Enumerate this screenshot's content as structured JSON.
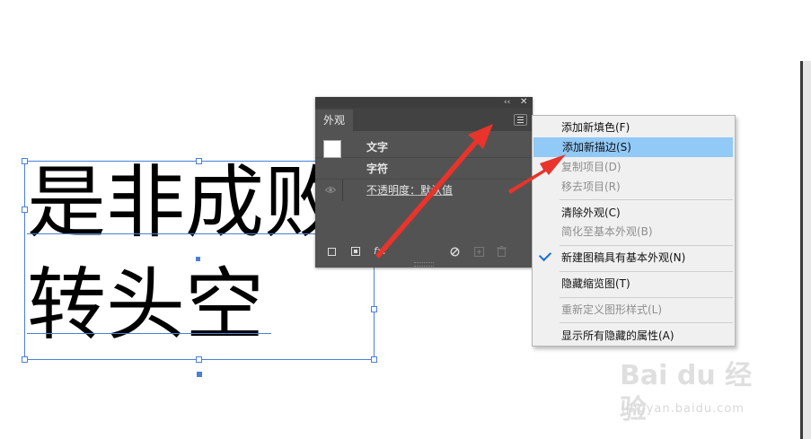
{
  "canvas": {
    "text_line1": "是非成败",
    "text_line2": "转头空"
  },
  "panel": {
    "tab_label": "外观",
    "rows": [
      {
        "label": "文字"
      },
      {
        "label": "字符"
      },
      {
        "label": "不透明度：默认值"
      }
    ],
    "collapse_glyph": "‹‹",
    "close_glyph": "✕",
    "fx_label": "fx."
  },
  "menu": {
    "items": [
      {
        "label": "添加新填色(F)",
        "enabled": true
      },
      {
        "label": "添加新描边(S)",
        "enabled": true,
        "highlighted": true
      },
      {
        "label": "复制项目(D)",
        "enabled": false
      },
      {
        "label": "移去项目(R)",
        "enabled": false
      },
      {
        "label": "清除外观(C)",
        "enabled": true
      },
      {
        "label": "简化至基本外观(B)",
        "enabled": false
      },
      {
        "label": "新建图稿具有基本外观(N)",
        "enabled": true,
        "checked": true
      },
      {
        "label": "隐藏缩览图(T)",
        "enabled": true
      },
      {
        "label": "重新定义图形样式(L)",
        "enabled": false
      },
      {
        "label": "显示所有隐藏的属性(A)",
        "enabled": true
      }
    ]
  },
  "watermark": {
    "logo": "Bai du 经验",
    "url": "jingyan.baidu.com"
  },
  "colors": {
    "panel_bg": "#535353",
    "selection_blue": "#4a7fd4",
    "menu_highlight": "#91c9f7",
    "arrow_red": "#e8342b"
  }
}
